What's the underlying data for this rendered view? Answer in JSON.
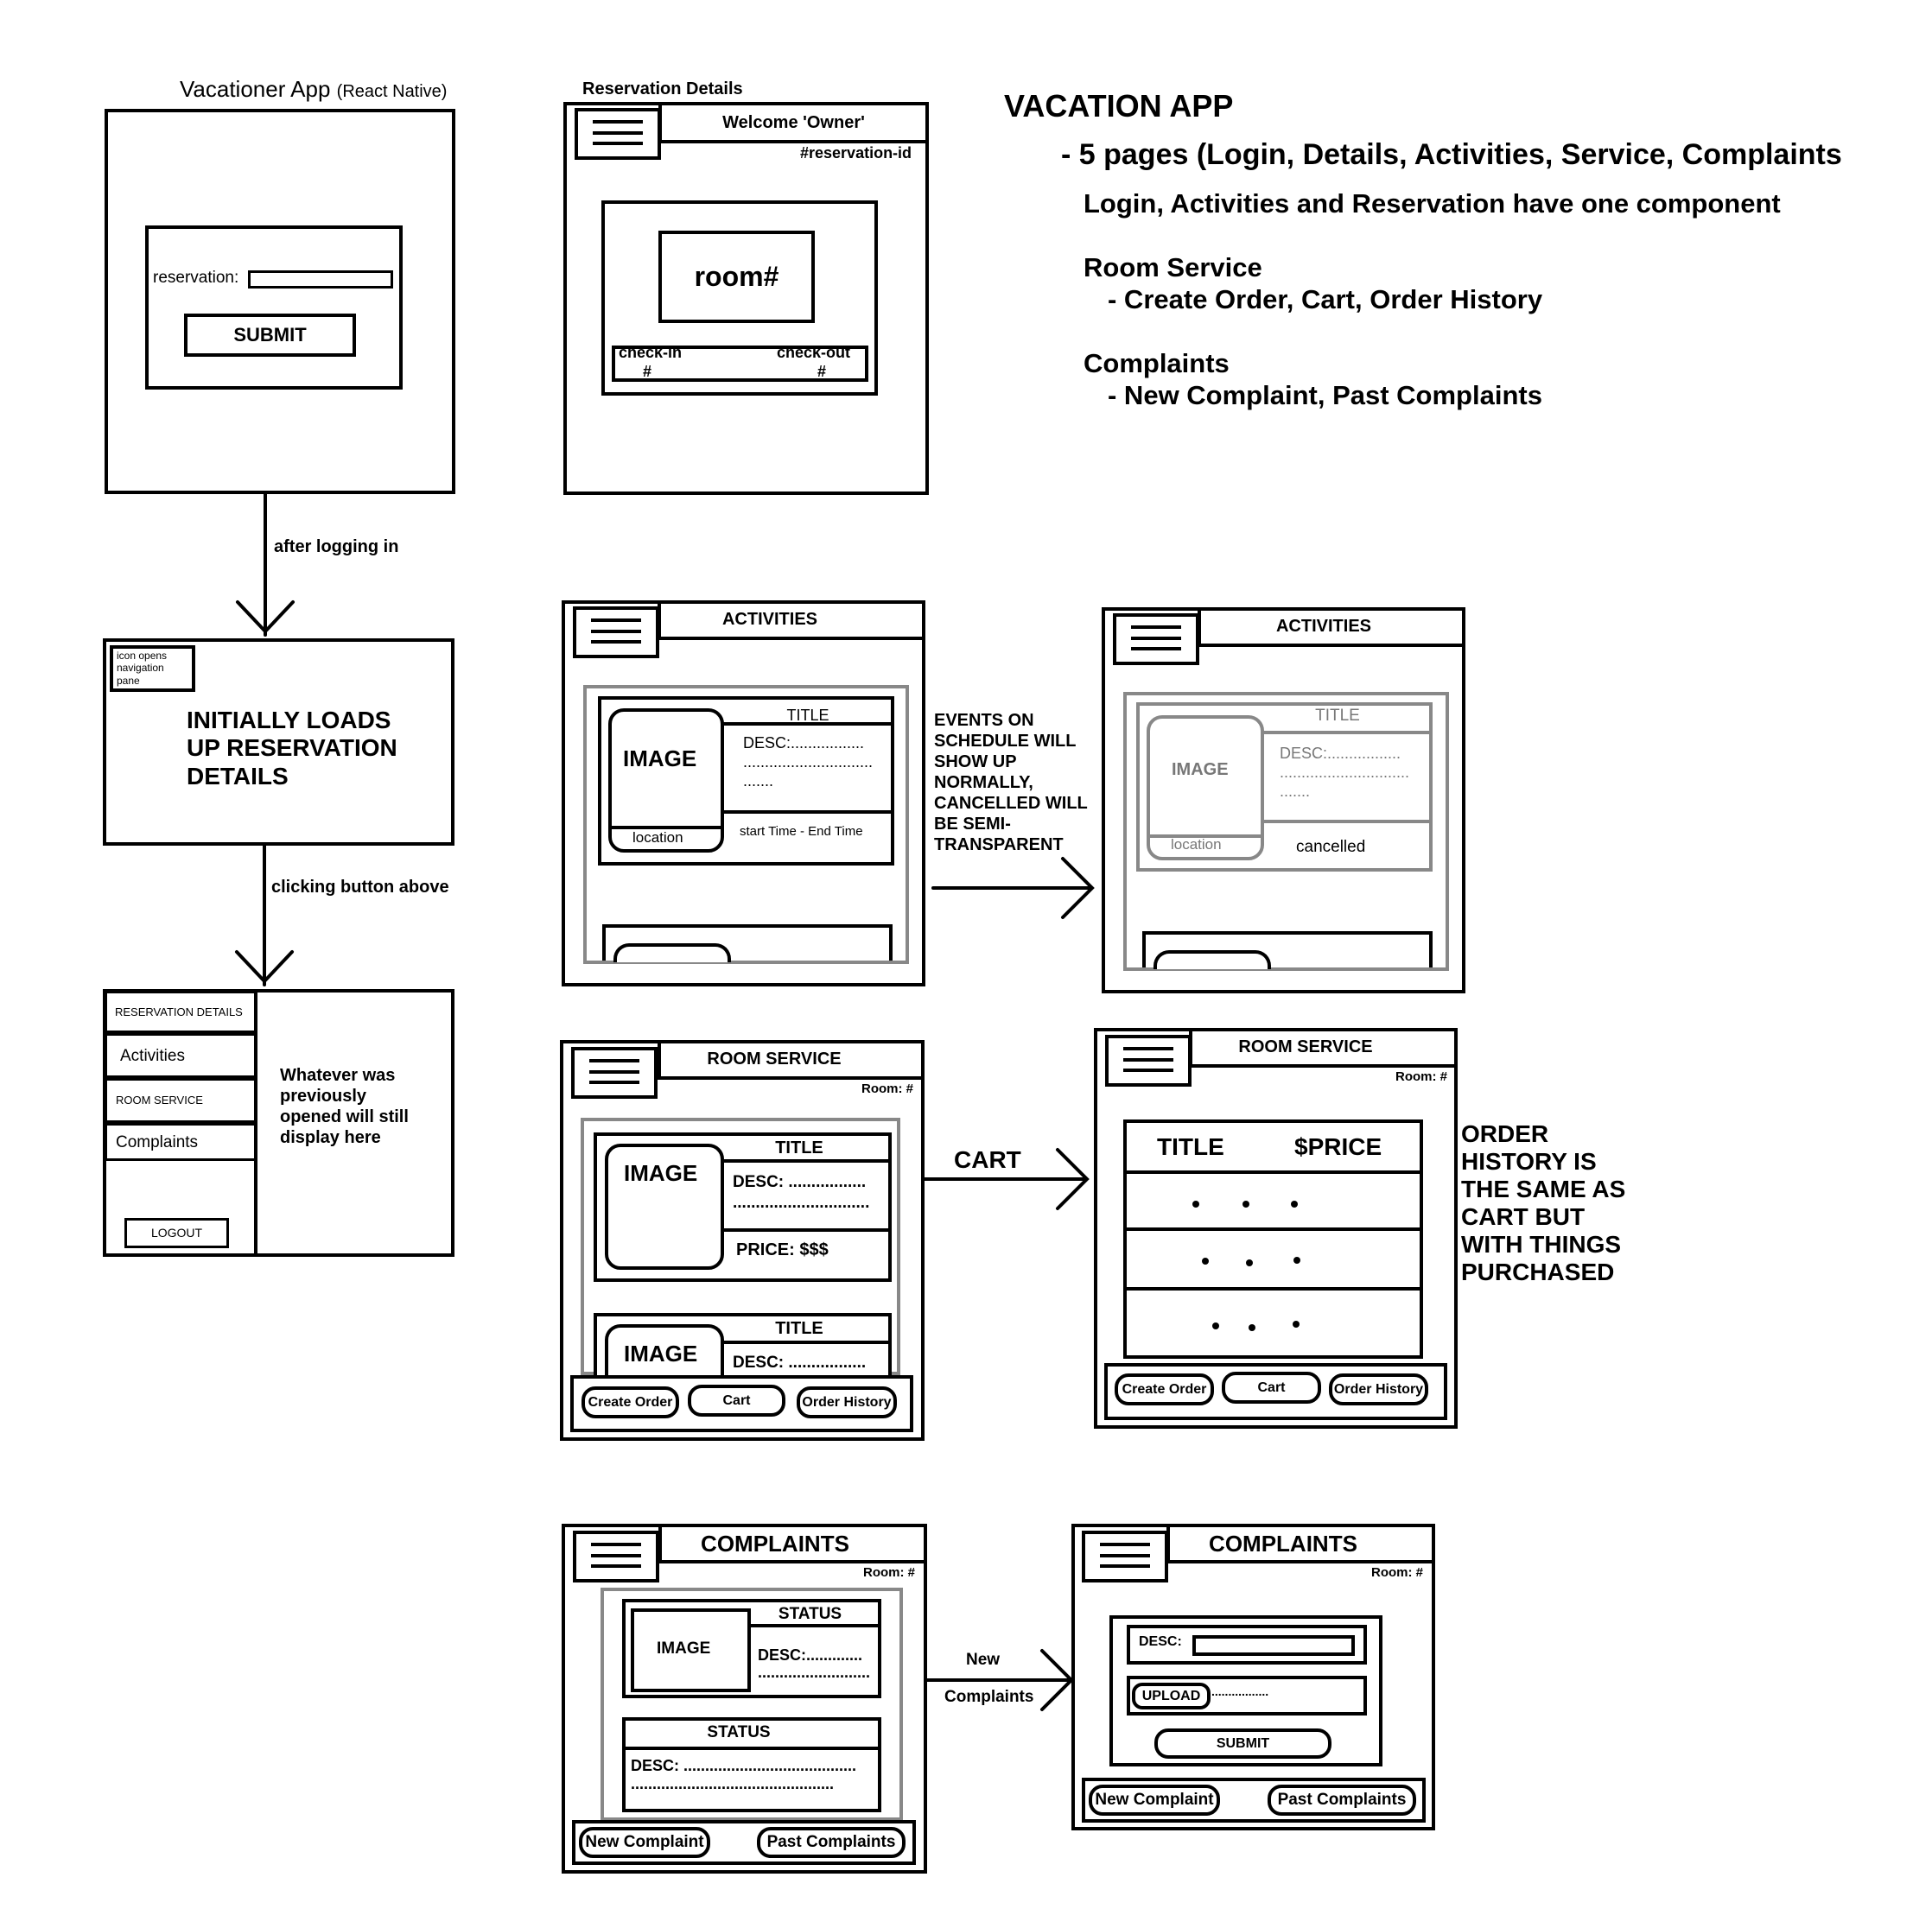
{
  "login_screen": {
    "title": "Vacationer App",
    "subtitle": "(React Native)",
    "reservation_label": "reservation:",
    "submit": "SUBMIT"
  },
  "flow": {
    "after_login": "after logging in",
    "clicking_button": "clicking button above"
  },
  "initial_screen": {
    "icon_note": "icon opens\nnavigation\npane",
    "text": "INITIALLY LOADS\nUP RESERVATION\nDETAILS"
  },
  "nav_pane": {
    "items": [
      "RESERVATION DETAILS",
      "Activities",
      "ROOM SERVICE",
      "Complaints"
    ],
    "logout": "LOGOUT",
    "note": "Whatever was\npreviously\nopened will still\ndisplay here"
  },
  "reservation_details": {
    "caption": "Reservation Details",
    "welcome": "Welcome 'Owner'",
    "reservation_id": "#reservation-id",
    "room": "room#",
    "checkin": "check-in",
    "checkout": "check-out",
    "hash": "#"
  },
  "notes": {
    "title": "VACATION APP",
    "pages": "- 5 pages (Login, Details, Activities, Service, Complaints",
    "one_component": "Login, Activities and Reservation have one component",
    "room_service_head": "Room Service",
    "room_service_items": "- Create Order, Cart, Order History",
    "complaints_head": "Complaints",
    "complaints_items": "- New Complaint, Past Complaints"
  },
  "activities": {
    "header": "ACTIVITIES",
    "title": "TITLE",
    "image": "IMAGE",
    "desc": "DESC:.................",
    "desc2": "..............................",
    "desc3": ".......",
    "location": "location",
    "time": "start Time - End Time",
    "cancelled": "cancelled",
    "note": "EVENTS ON\nSCHEDULE WILL\nSHOW UP\nNORMALLY,\nCANCELLED WILL\nBE SEMI-\nTRANSPARENT"
  },
  "room_service": {
    "header": "ROOM SERVICE",
    "room": "Room: #",
    "title": "TITLE",
    "image": "IMAGE",
    "desc": "DESC: .................",
    "desc2": "..............................",
    "price": "PRICE: $$$",
    "cart_label": "CART",
    "cart_title": "TITLE",
    "cart_price": "$PRICE",
    "tabs": [
      "Create Order",
      "Cart",
      "Order History"
    ],
    "note": "ORDER\nHISTORY IS\nTHE SAME AS\nCART BUT\nWITH THINGS\nPURCHASED"
  },
  "complaints": {
    "header": "COMPLAINTS",
    "room": "Room: #",
    "status": "STATUS",
    "image": "IMAGE",
    "desc_short": "DESC:.............",
    "desc_short2": "..........................",
    "desc_long": "DESC: ........................................",
    "desc_long2": "...............................................",
    "new_label_1": "New",
    "new_label_2": "Complaints",
    "form_desc": "DESC:",
    "upload": "UPLOAD",
    "upload_dots": ".................",
    "submit": "SUBMIT",
    "tabs": [
      "New Complaint",
      "Past Complaints"
    ]
  }
}
